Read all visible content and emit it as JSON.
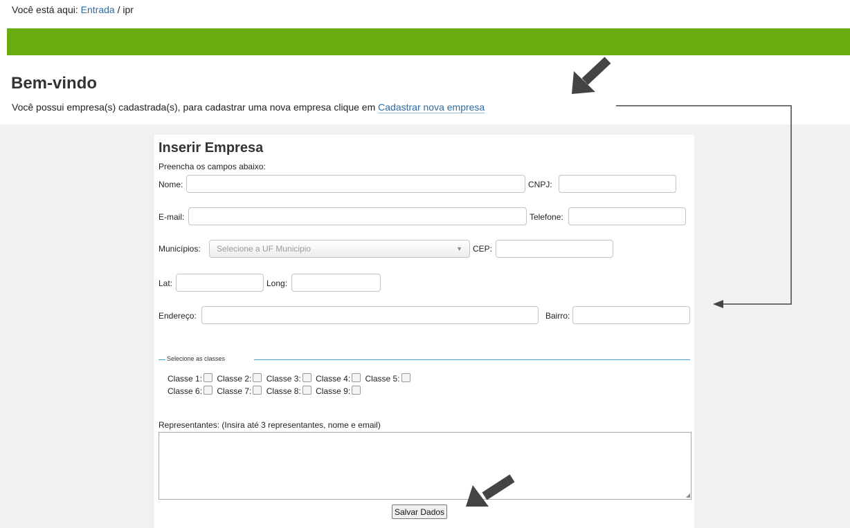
{
  "breadcrumb": {
    "prefix": "Você está aqui:",
    "home": "Entrada",
    "separator": "/",
    "current": "ipr"
  },
  "welcome": {
    "title": "Bem-vindo",
    "text": "Você possui empresa(s) cadastrada(s), para cadastrar uma nova empresa clique em",
    "link": "Cadastrar nova empresa"
  },
  "form": {
    "title": "Inserir Empresa",
    "subtitle": "Preencha os campos abaixo:",
    "fields": {
      "nome": "Nome:",
      "cnpj": "CNPJ:",
      "email": "E-mail:",
      "telefone": "Telefone:",
      "municipios": "Municípios:",
      "municipios_placeholder": "Selecione a UF Municipio",
      "cep": "CEP:",
      "lat": "Lat:",
      "long": "Long:",
      "endereco": "Endereço:",
      "bairro": "Bairro:"
    },
    "classes_legend": "Selecione as classes",
    "classes": [
      "Classe 1:",
      "Classe 2:",
      "Classe 3:",
      "Classe 4:",
      "Classe 5:",
      "Classe 6:",
      "Classe 7:",
      "Classe 8:",
      "Classe 9:"
    ],
    "representantes_label": "Representantes: (Insira até 3 representantes, nome e email)",
    "submit": "Salvar Dados"
  },
  "colors": {
    "accent_bar": "#6aab10",
    "link": "#2d6aa0",
    "annotation": "#444444"
  }
}
